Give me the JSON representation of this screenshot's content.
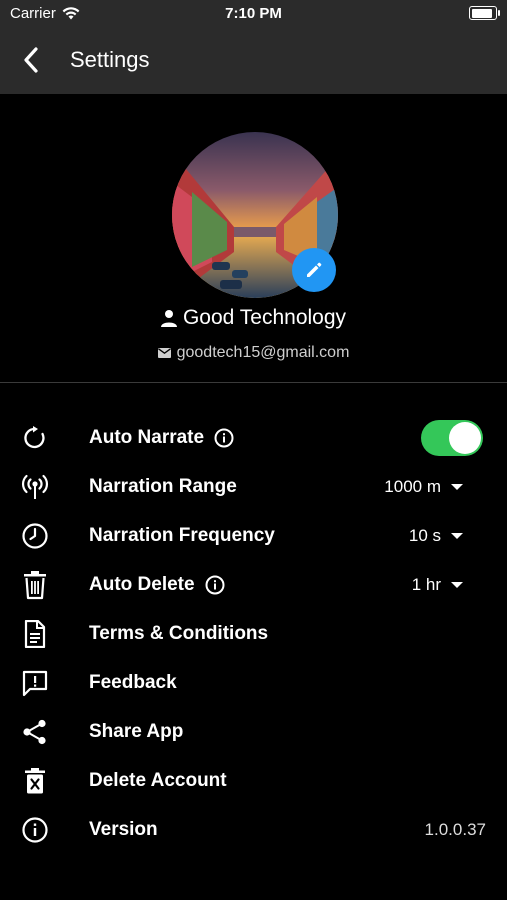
{
  "status_bar": {
    "carrier": "Carrier",
    "time": "7:10 PM"
  },
  "header": {
    "title": "Settings"
  },
  "profile": {
    "name": "Good Technology",
    "email": "goodtech15@gmail.com"
  },
  "settings": {
    "auto_narrate": {
      "label": "Auto Narrate",
      "enabled": true
    },
    "narration_range": {
      "label": "Narration Range",
      "value": "1000 m"
    },
    "narration_frequency": {
      "label": "Narration Frequency",
      "value": "10 s"
    },
    "auto_delete": {
      "label": "Auto Delete",
      "value": "1 hr"
    },
    "terms": {
      "label": "Terms & Conditions"
    },
    "feedback": {
      "label": "Feedback"
    },
    "share": {
      "label": "Share App"
    },
    "delete_account": {
      "label": "Delete Account"
    },
    "version": {
      "label": "Version",
      "value": "1.0.0.37"
    }
  },
  "colors": {
    "accent": "#2196f3",
    "toggle_on": "#34c759",
    "bar_bg": "#2b2b2b"
  }
}
